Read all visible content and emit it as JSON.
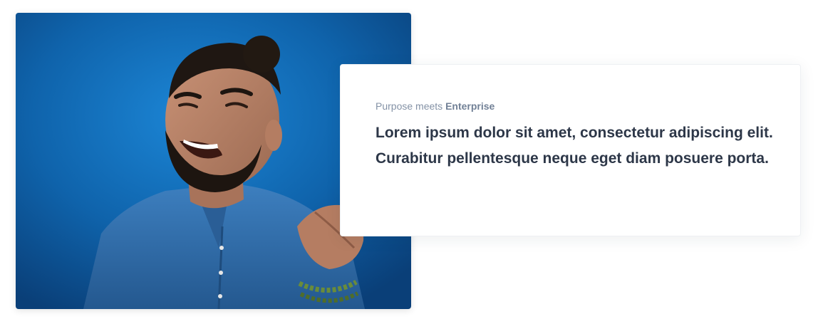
{
  "image": {
    "alt_subject": "laughing-man-pointing",
    "background_color": "#0e64a8"
  },
  "card": {
    "eyebrow_prefix": "Purpose meets ",
    "eyebrow_bold": "Enterprise",
    "lead_text": "Lorem ipsum dolor sit amet, consectetur adipiscing elit. Curabitur pellentesque neque eget diam posuere porta."
  },
  "colors": {
    "eyebrow": "#8492a6",
    "lead": "#2d3748",
    "accent_blue": "#1a73c7"
  }
}
